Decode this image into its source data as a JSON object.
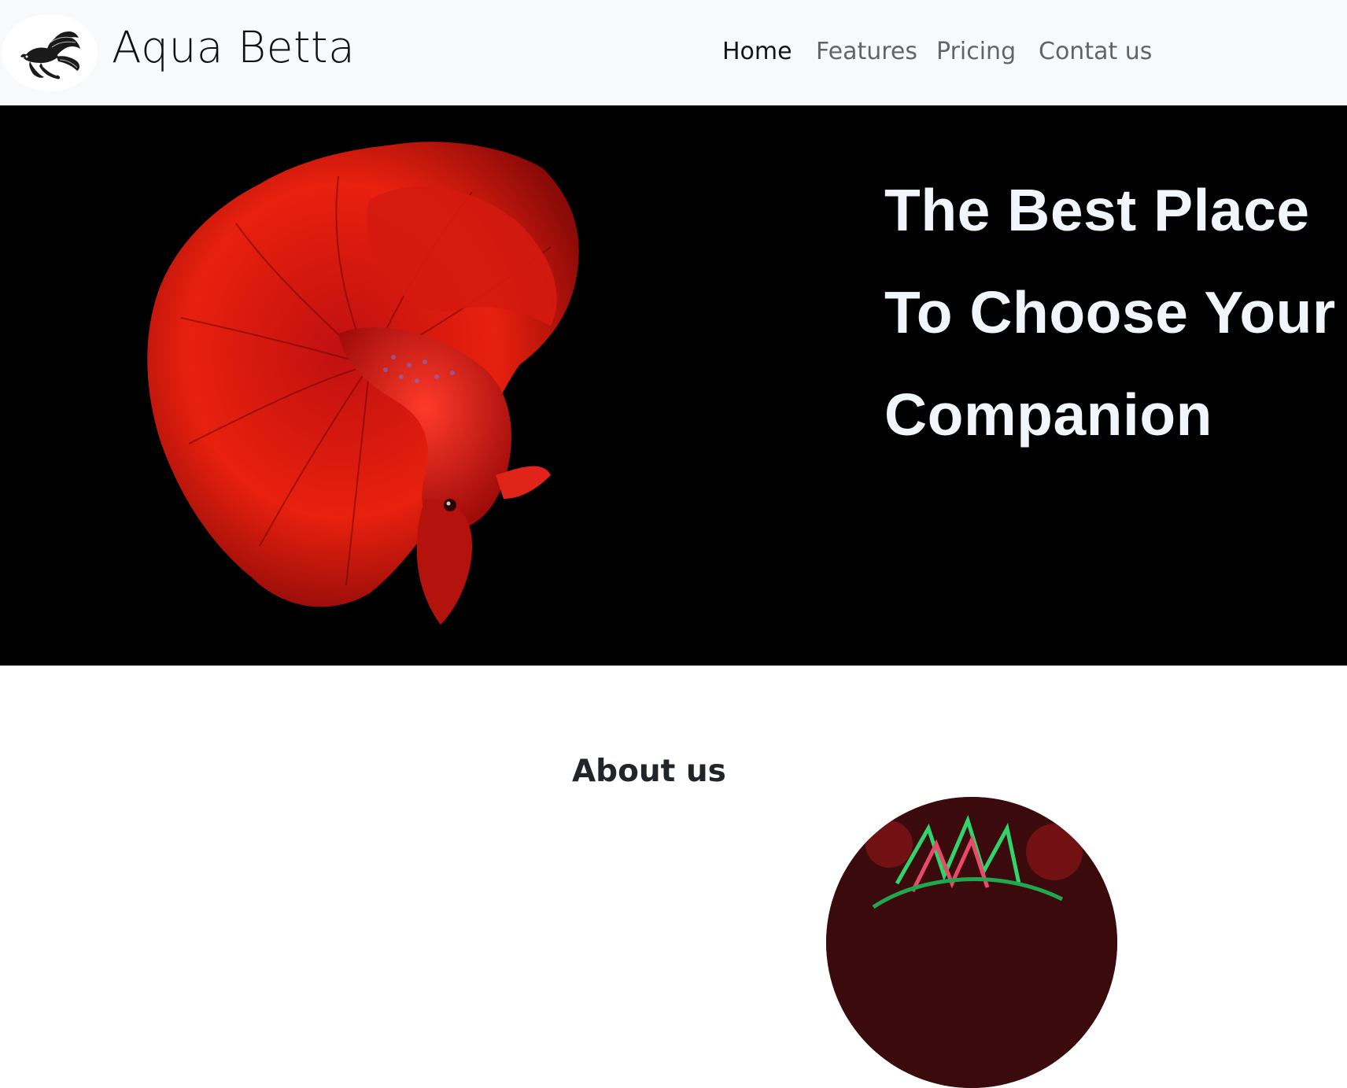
{
  "navbar": {
    "brand": "Aqua Betta",
    "logo_icon": "betta-fish-logo-icon",
    "links": [
      {
        "label": "Home",
        "active": true
      },
      {
        "label": "Features",
        "active": false
      },
      {
        "label": "Pricing",
        "active": false
      },
      {
        "label": "Contat us",
        "active": false
      }
    ]
  },
  "hero": {
    "title_lines": [
      "The Best Place",
      "To Choose Your",
      "Companion"
    ],
    "image": "red-betta-fish-image",
    "background": "#000000",
    "text_color": "#f0f6fc"
  },
  "about": {
    "title": "About us",
    "image": "colorful-betta-circle-image"
  }
}
